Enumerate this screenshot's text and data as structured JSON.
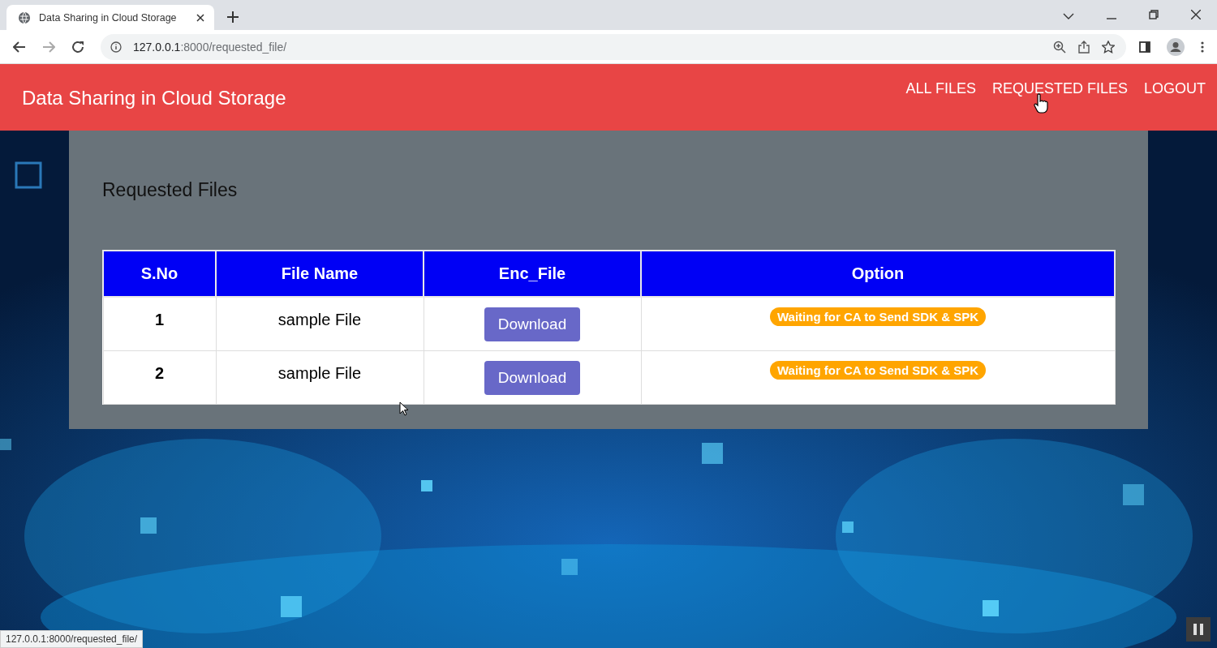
{
  "browser": {
    "tab_title": "Data Sharing in Cloud Storage",
    "url_host": "127.0.0.1",
    "url_path": ":8000/requested_file/"
  },
  "navbar": {
    "brand": "Data Sharing in Cloud Storage",
    "links": [
      "ALL FILES",
      "REQUESTED FILES",
      "LOGOUT"
    ]
  },
  "page": {
    "title": "Requested Files",
    "table": {
      "columns": [
        "S.No",
        "File Name",
        "Enc_File",
        "Option"
      ],
      "rows": [
        {
          "sno": "1",
          "file_name": "sample File",
          "action": "Download",
          "status": "Waiting for CA to Send SDK & SPK"
        },
        {
          "sno": "2",
          "file_name": "sample File",
          "action": "Download",
          "status": "Waiting for CA to Send SDK & SPK"
        }
      ]
    }
  },
  "status_bubble": "127.0.0.1:8000/requested_file/"
}
